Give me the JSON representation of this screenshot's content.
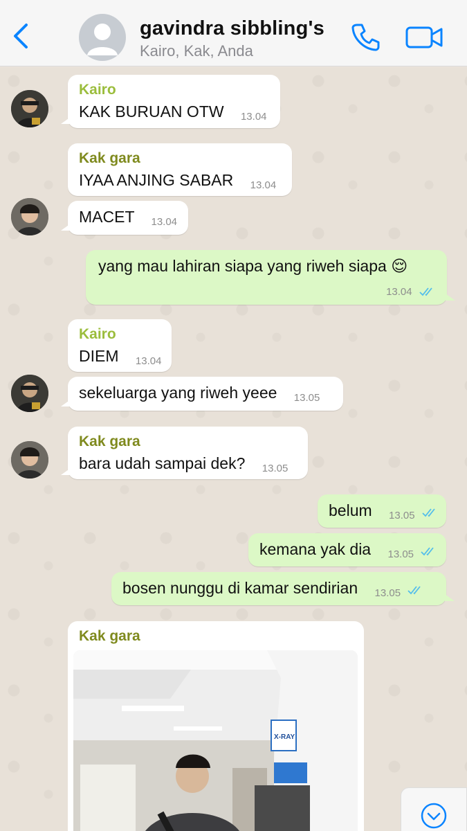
{
  "header": {
    "title": "gavindra sibbling's",
    "subtitle": "Kairo, Kak, Anda"
  },
  "messages": [
    {
      "sender": "Kairo",
      "text": "KAK BURUAN OTW",
      "time": "13.04"
    },
    {
      "sender": "Kak gara",
      "text": "IYAA ANJING SABAR",
      "time": "13.04"
    },
    {
      "sender": "",
      "text": "MACET",
      "time": "13.04"
    },
    {
      "sender": "",
      "text": "yang mau lahiran siapa yang riweh siapa 😌",
      "time": "13.04"
    },
    {
      "sender": "Kairo",
      "text": "DIEM",
      "time": "13.04"
    },
    {
      "sender": "",
      "text": "sekeluarga yang riweh yeee",
      "time": "13.05"
    },
    {
      "sender": "Kak gara",
      "text": "bara udah sampai dek?",
      "time": "13.05"
    },
    {
      "sender": "",
      "text": "belum",
      "time": "13.05"
    },
    {
      "sender": "",
      "text": "kemana yak dia",
      "time": "13.05"
    },
    {
      "sender": "",
      "text": "bosen nunggu di kamar sendirian",
      "time": "13.05"
    },
    {
      "sender": "Kak gara",
      "text": "",
      "time": ""
    }
  ],
  "photo": {
    "sign_xray": "X-RAY"
  },
  "colors": {
    "accent": "#0a84ff",
    "outgoing": "#dcf8c6",
    "incoming": "#ffffff",
    "kairo": "#9bbd3c",
    "gara": "#7f8a1e",
    "read_ticks": "#53bdeb"
  },
  "icons": [
    "back-arrow-icon",
    "group-avatar-icon",
    "phone-icon",
    "video-camera-icon",
    "double-check-icon",
    "chevron-down-icon"
  ]
}
